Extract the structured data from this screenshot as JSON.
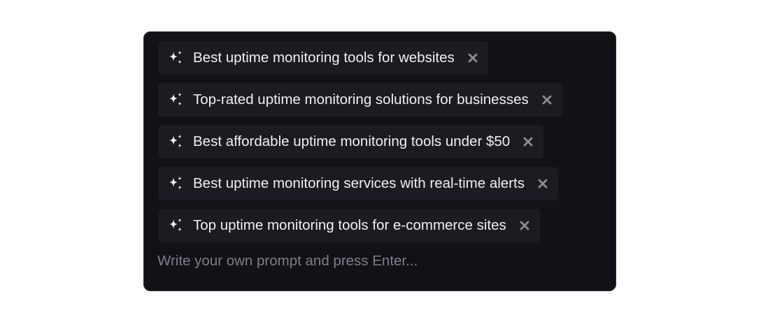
{
  "suggestions": [
    {
      "label": "Best uptime monitoring tools for websites",
      "icon": "sparkles-icon",
      "remove_icon": "close-icon"
    },
    {
      "label": "Top-rated uptime monitoring solutions for businesses",
      "icon": "sparkles-icon",
      "remove_icon": "close-icon"
    },
    {
      "label": "Best affordable uptime monitoring tools under $50",
      "icon": "sparkles-icon",
      "remove_icon": "close-icon"
    },
    {
      "label": "Best uptime monitoring services with real-time alerts",
      "icon": "sparkles-icon",
      "remove_icon": "close-icon"
    },
    {
      "label": "Top uptime monitoring tools for e-commerce sites",
      "icon": "sparkles-icon",
      "remove_icon": "close-icon"
    }
  ],
  "prompt_input": {
    "value": "",
    "placeholder": "Write your own prompt and press Enter..."
  },
  "colors": {
    "panel_background": "#111216",
    "chip_background": "#1a1c22",
    "chip_text": "#eef0f4",
    "icon": "#f2f3f5",
    "close_icon": "#8a8d95",
    "placeholder": "#7b7f88"
  }
}
